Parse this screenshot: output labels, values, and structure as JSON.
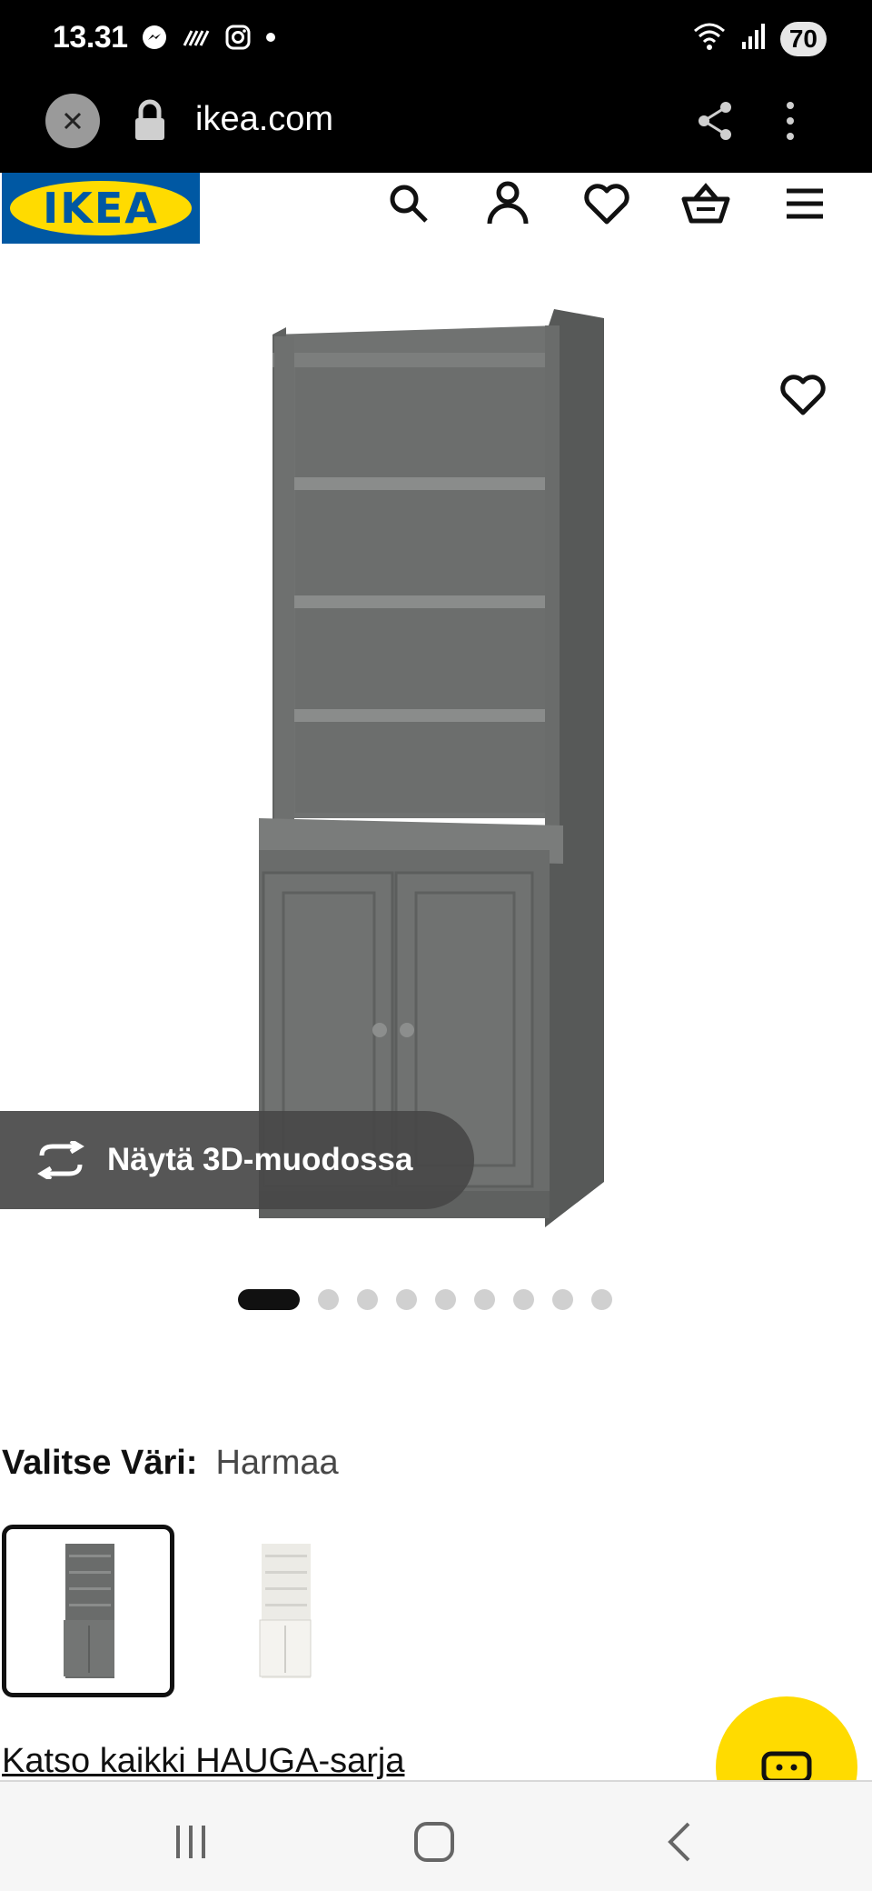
{
  "status_bar": {
    "time": "13.31",
    "battery": "70",
    "icons_left": [
      "messenger-icon",
      "signal-lines-icon",
      "instagram-icon",
      "dot-icon"
    ],
    "icons_right": [
      "wifi-icon",
      "cell-signal-icon",
      "battery-icon"
    ]
  },
  "browser": {
    "url": "ikea.com",
    "close_icon": "close-icon",
    "lock_icon": "lock-icon",
    "share_icon": "share-icon",
    "more_icon": "more-vertical-icon"
  },
  "header": {
    "logo_text": "IKEA",
    "icons": [
      "search-icon",
      "account-icon",
      "favorites-icon",
      "cart-icon",
      "menu-icon"
    ]
  },
  "product": {
    "view_3d_label": "Näytä 3D-muodossa",
    "carousel": {
      "total": 9,
      "active": 1
    }
  },
  "color_selector": {
    "label": "Valitse Väri:",
    "value": "Harmaa",
    "options": [
      {
        "name": "Harmaa",
        "color": "#6a6c6b",
        "selected": true
      },
      {
        "name": "Valkoinen",
        "color": "#f2f1ec",
        "selected": false
      }
    ]
  },
  "series_link": "Katso kaikki HAUGA-sarja",
  "colors": {
    "ikea_blue": "#0058a3",
    "ikea_yellow": "#ffdb00",
    "furniture_gray": "#6a6c6b"
  },
  "nav": [
    "recent-apps-icon",
    "home-icon",
    "back-icon"
  ]
}
